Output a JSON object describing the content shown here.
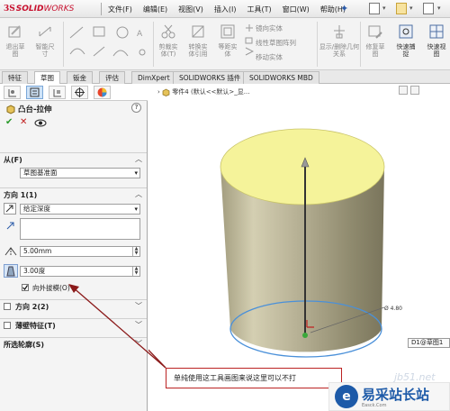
{
  "app": {
    "logo_ds": "3S",
    "logo_brand": "SOLID",
    "logo_brand2": "WORKS"
  },
  "menu": [
    {
      "label": "文件(F)"
    },
    {
      "label": "编辑(E)"
    },
    {
      "label": "视图(V)"
    },
    {
      "label": "插入(I)"
    },
    {
      "label": "工具(T)"
    },
    {
      "label": "窗口(W)"
    },
    {
      "label": "帮助(H)"
    }
  ],
  "ribbon": {
    "exit_sketch": "退出草\n图",
    "smart_dim": "智能尺\n寸",
    "cut_entities": "剪裁实\n体(T)",
    "convert_entities": "转换实\n体引用",
    "offset_entities": "等距实\n体",
    "mirror_entities": "镜向实体",
    "linear_pattern": "线性草图阵列",
    "move_entities": "移动实体",
    "display_relations": "显示/删除几何\n关系",
    "repair_sketch": "修复草\n图",
    "quick_snaps": "快速捕\n捉",
    "quick_view": "快速视\n图"
  },
  "tabs": [
    {
      "label": "特征"
    },
    {
      "label": "草图"
    },
    {
      "label": "钣金"
    },
    {
      "label": "评估"
    },
    {
      "label": "DimXpert"
    },
    {
      "label": "SOLIDWORKS 插件"
    },
    {
      "label": "SOLIDWORKS MBD"
    }
  ],
  "active_tab": "草图",
  "property_manager": {
    "title": "凸台-拉伸",
    "help": "?",
    "from": {
      "header": "从(F)",
      "value": "草图基准面"
    },
    "direction1": {
      "header": "方向 1(1)",
      "end_condition": "给定深度",
      "depth": "5.00mm",
      "draft_angle": "3.00度",
      "draft_outward_label": "向外拔模(O)",
      "draft_outward_checked": true
    },
    "direction2": {
      "header": "方向 2(2)",
      "checked": false
    },
    "thin_feature": {
      "header": "薄壁特征(T)",
      "checked": false
    },
    "selected_contours": {
      "header": "所选轮廓(S)"
    }
  },
  "graphics": {
    "breadcrumb": "零件4 (默认<<默认>_显...",
    "dimension_text": "Ø 4.80",
    "dimension_label": "D1@草图1"
  },
  "annotation": {
    "callout_text": "单纯使用这工具画图来说这里可以不打",
    "watermark_url": "jb51.net",
    "watermark_logo": "e",
    "watermark_name": "易采站长站",
    "watermark_sub": "Easck.Com"
  },
  "colors": {
    "brand_red": "#c8102e",
    "ok_green": "#2a9a2a",
    "cancel_red": "#c02020",
    "top_face": "#f5f39a",
    "cylinder_body": "#b8b292",
    "base_circle": "#4a90d9",
    "callout_arrow": "#8b1a1a"
  }
}
